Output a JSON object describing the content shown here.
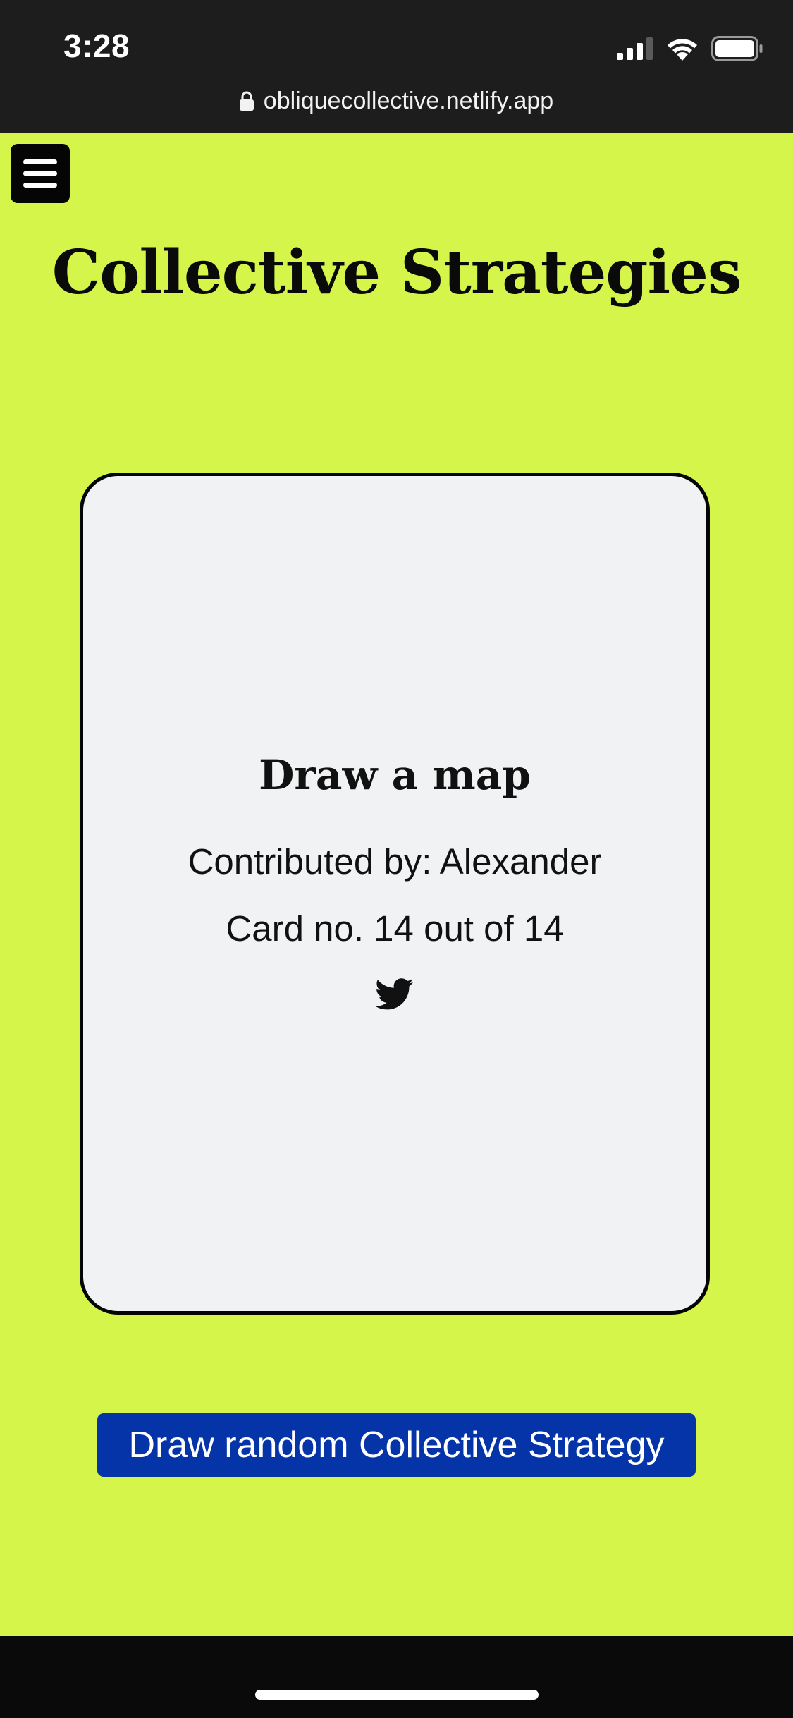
{
  "status_bar": {
    "time": "3:28",
    "icons": [
      "signal-icon",
      "wifi-icon",
      "battery-icon"
    ]
  },
  "browser": {
    "url": "obliquecollective.netlify.app",
    "lock_icon": "lock-icon"
  },
  "header": {
    "menu_icon": "hamburger-menu-icon",
    "title": "Collective Strategies"
  },
  "card": {
    "title": "Draw a map",
    "contributed_by": "Contributed by: Alexander",
    "card_number": "Card no. 14 out of 14",
    "share_icon": "twitter-icon"
  },
  "actions": {
    "draw_button_label": "Draw random Collective Strategy"
  },
  "colors": {
    "page_background": "#d5f54a",
    "card_background": "#f1f2f4",
    "button_background": "#0533a8",
    "chrome_background": "#1d1d1d"
  }
}
